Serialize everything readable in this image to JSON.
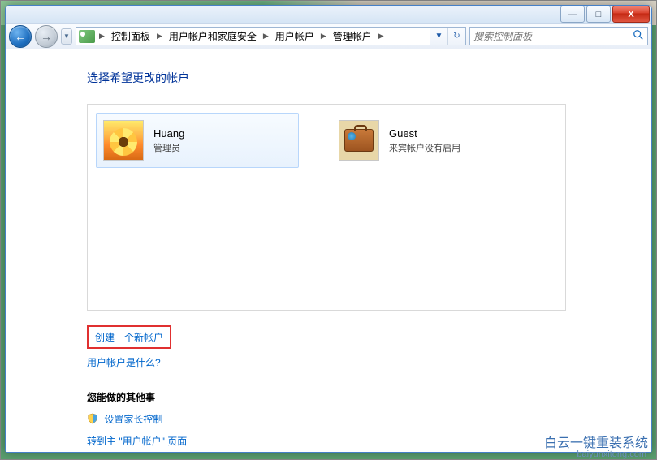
{
  "titlebar": {
    "minimize": "—",
    "maximize": "□",
    "close": "X"
  },
  "nav": {
    "back_arrow": "←",
    "fwd_arrow": "→",
    "dropdown": "▼",
    "refresh": "↻"
  },
  "breadcrumb": {
    "items": [
      "控制面板",
      "用户帐户和家庭安全",
      "用户帐户",
      "管理帐户"
    ],
    "sep": "▶"
  },
  "search": {
    "placeholder": "搜索控制面板"
  },
  "page": {
    "title": "选择希望更改的帐户"
  },
  "accounts": [
    {
      "name": "Huang",
      "role": "管理员",
      "avatar": "flower",
      "selected": true
    },
    {
      "name": "Guest",
      "role": "来宾帐户没有启用",
      "avatar": "suitcase",
      "selected": false
    }
  ],
  "links": {
    "create_new": "创建一个新帐户",
    "what_is": "用户帐户是什么?",
    "other_heading": "您能做的其他事",
    "parental": "设置家长控制",
    "goto_main": "转到主 \"用户帐户\" 页面"
  },
  "watermark": {
    "text": "白云一键重装系统",
    "url": "baiyunxitong.com"
  }
}
